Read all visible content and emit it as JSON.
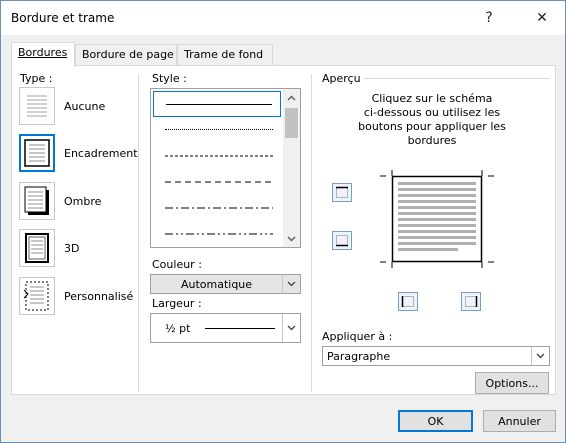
{
  "window": {
    "title": "Bordure et trame",
    "help_glyph": "?",
    "close_glyph": "✕"
  },
  "tabs": [
    {
      "label": "Bordures",
      "active": true
    },
    {
      "label": "Bordure de page",
      "active": false
    },
    {
      "label": "Trame de fond",
      "active": false
    }
  ],
  "type_section": {
    "label": "Type :",
    "items": [
      {
        "label": "Aucune",
        "selected": false,
        "icon": "border-none-icon"
      },
      {
        "label": "Encadrement",
        "selected": true,
        "icon": "border-box-icon"
      },
      {
        "label": "Ombre",
        "selected": false,
        "icon": "border-shadow-icon"
      },
      {
        "label": "3D",
        "selected": false,
        "icon": "border-3d-icon"
      },
      {
        "label": "Personnalisé",
        "selected": false,
        "icon": "border-custom-icon"
      }
    ]
  },
  "style_section": {
    "label": "Style :",
    "styles": [
      "solid",
      "dotted",
      "dashed-small",
      "dashed",
      "dash-dot",
      "dash-dot-dot"
    ],
    "selected_index": 0
  },
  "color_section": {
    "label": "Couleur :",
    "value": "Automatique"
  },
  "width_section": {
    "label": "Largeur :",
    "value": "½ pt"
  },
  "preview_section": {
    "label": "Aperçu",
    "instructions": [
      "Cliquez sur le schéma",
      "ci-dessous ou utilisez les",
      "boutons pour appliquer les",
      "bordures"
    ]
  },
  "apply_section": {
    "label": "Appliquer à :",
    "value": "Paragraphe"
  },
  "buttons": {
    "options": "Options...",
    "ok": "OK",
    "cancel": "Annuler"
  },
  "colors": {
    "accent": "#0078d7",
    "dialog_bg": "#f0f0f0",
    "panel_bg": "#ffffff"
  }
}
